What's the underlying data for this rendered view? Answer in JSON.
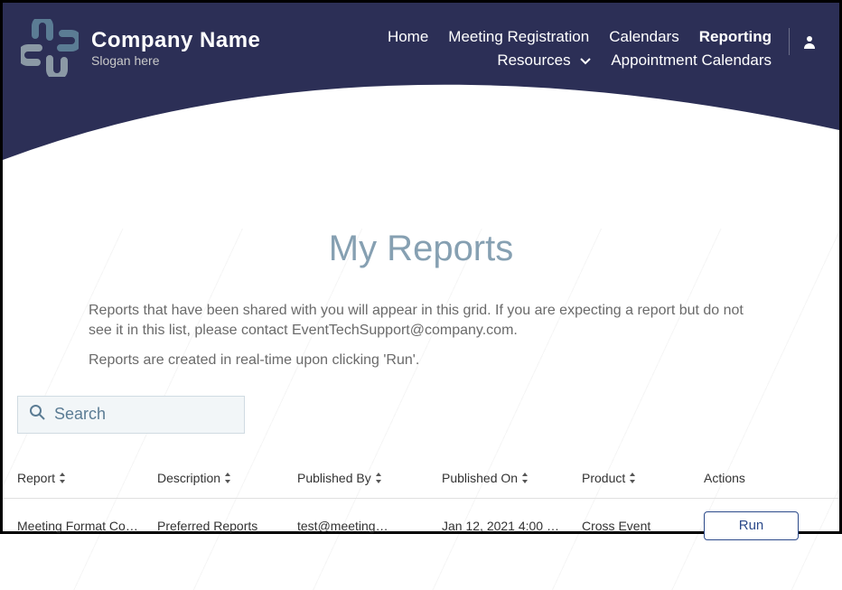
{
  "brand": {
    "company": "Company Name",
    "slogan": "Slogan here"
  },
  "nav": {
    "home": "Home",
    "meeting_reg": "Meeting Registration",
    "calendars": "Calendars",
    "reporting": "Reporting",
    "resources": "Resources",
    "appt_calendars": "Appointment Calendars"
  },
  "page": {
    "title": "My Reports",
    "desc1": "Reports that have been shared with you will appear in this grid. If you are expecting a report but do not see it in this list, please contact EventTechSupport@company.com.",
    "desc2": "Reports are created in real-time upon clicking 'Run'."
  },
  "search": {
    "placeholder": "Search"
  },
  "table": {
    "headers": {
      "report": "Report",
      "description": "Description",
      "published_by": "Published By",
      "published_on": "Published On",
      "product": "Product",
      "actions": "Actions"
    },
    "rows": [
      {
        "report": "Meeting Format Co…",
        "description": "Preferred Reports",
        "published_by": "test@meeting…",
        "published_on": "Jan 12, 2021 4:00 …",
        "product": "Cross Event",
        "action": "Run"
      }
    ]
  }
}
